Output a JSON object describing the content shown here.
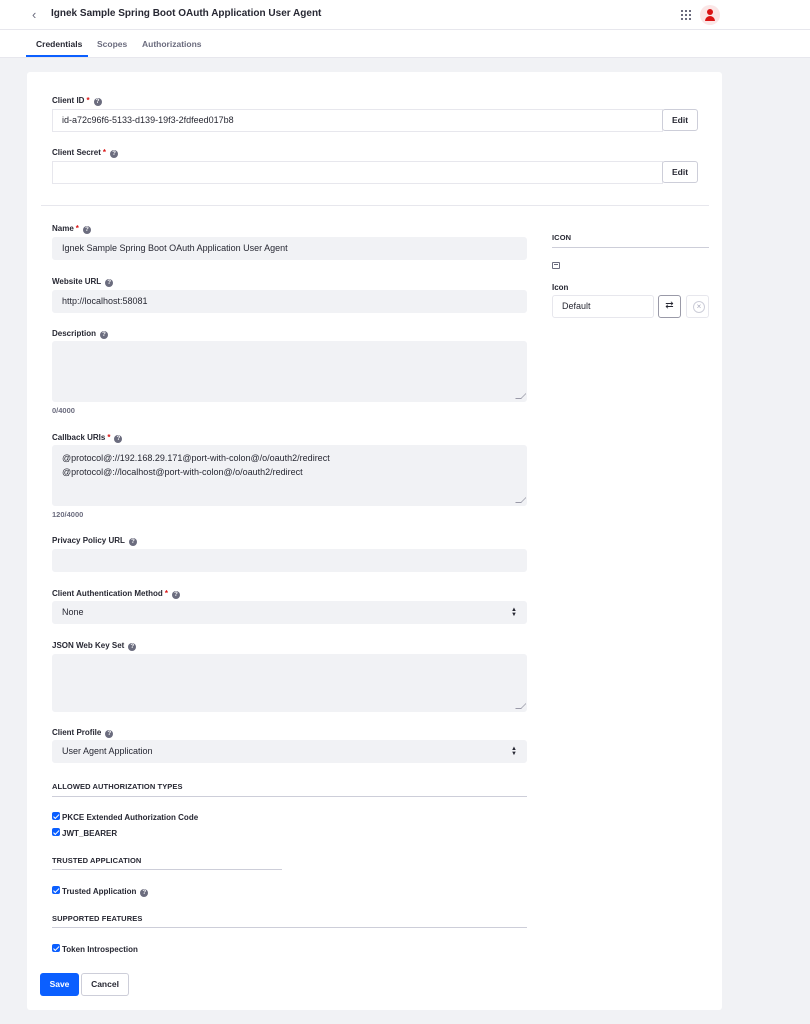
{
  "header": {
    "back_glyph": "‹",
    "title": "Ignek Sample Spring Boot OAuth Application User Agent"
  },
  "tabs": [
    {
      "label": "Credentials",
      "active": true
    },
    {
      "label": "Scopes",
      "active": false
    },
    {
      "label": "Authorizations",
      "active": false
    }
  ],
  "credentials": {
    "client_id_label": "Client ID",
    "client_id_value": "id-a72c96f6-5133-d139-19f3-2fdfeed017b8",
    "client_secret_label": "Client Secret",
    "client_secret_value": "",
    "edit_label": "Edit"
  },
  "form": {
    "name_label": "Name",
    "name_value": "Ignek Sample Spring Boot OAuth Application User Agent",
    "website_label": "Website URL",
    "website_value": "http://localhost:58081",
    "description_label": "Description",
    "description_value": "",
    "description_counter": "0/4000",
    "callback_label": "Callback URIs",
    "callback_value": "@protocol@://192.168.29.171@port-with-colon@/o/oauth2/redirect\n@protocol@://localhost@port-with-colon@/o/oauth2/redirect",
    "callback_counter": "120/4000",
    "privacy_label": "Privacy Policy URL",
    "privacy_value": "",
    "auth_method_label": "Client Authentication Method",
    "auth_method_value": "None",
    "jwks_label": "JSON Web Key Set",
    "jwks_value": "",
    "profile_label": "Client Profile",
    "profile_value": "User Agent Application"
  },
  "sections": {
    "allowed_types": "ALLOWED AUTHORIZATION TYPES",
    "pkce": "PKCE Extended Authorization Code",
    "jwt": "JWT_BEARER",
    "trusted_app": "TRUSTED APPLICATION",
    "trusted_app_label": "Trusted Application",
    "supported_features": "SUPPORTED FEATURES",
    "token_introspection": "Token Introspection"
  },
  "icon_panel": {
    "heading": "ICON",
    "icon_label": "Icon",
    "icon_value": "Default"
  },
  "actions": {
    "save": "Save",
    "cancel": "Cancel"
  },
  "colors": {
    "primary": "#0b5fff",
    "required": "#da1414"
  },
  "icons": [
    "back-icon",
    "apps-grid-icon",
    "user-avatar-icon",
    "help-icon",
    "image-icon",
    "change-icon",
    "clear-icon",
    "select-arrow-icon",
    "checkbox-checked-icon"
  ]
}
